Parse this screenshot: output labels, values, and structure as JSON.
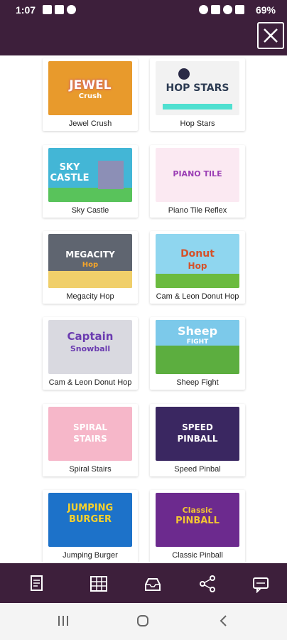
{
  "status_bar": {
    "time": "1:07",
    "battery": "69%",
    "left_icons": [
      "image-icon",
      "calendar-icon",
      "lock-icon"
    ],
    "right_icons": [
      "alarm-icon",
      "mute-icon",
      "wifi-icon",
      "signal-icon",
      "battery-icon"
    ]
  },
  "header": {
    "close_icon": "close-icon"
  },
  "games": [
    {
      "label": "Jewel Crush",
      "thumb_text": "JEWEL",
      "thumb_sub": "Crush",
      "bg": "#e89a2c",
      "fg": "#ffffff"
    },
    {
      "label": "Hop Stars",
      "thumb_text": "HOP STARS",
      "thumb_sub": "",
      "bg": "#f2f2f2",
      "fg": "#2c3b52"
    },
    {
      "label": "Sky Castle",
      "thumb_text": "SKY CASTLE",
      "thumb_sub": "",
      "bg": "#43b6d6",
      "fg": "#ffffff"
    },
    {
      "label": "Piano Tile Reflex",
      "thumb_text": "PIANO TILE",
      "thumb_sub": "",
      "bg": "#fbe9f2",
      "fg": "#9b3fb5"
    },
    {
      "label": "Megacity Hop",
      "thumb_text": "MEGACITY",
      "thumb_sub": "Hop",
      "bg": "#5f6570",
      "fg": "#ffffff"
    },
    {
      "label": "Cam & Leon Donut Hop",
      "thumb_text": "Donut",
      "thumb_sub": "Hop",
      "bg": "#8fd6ef",
      "fg": "#d5522a"
    },
    {
      "label": "Cam & Leon Donut Hop",
      "thumb_text": "Captain",
      "thumb_sub": "Snowball",
      "bg": "#d9d9e0",
      "fg": "#6b3cb0"
    },
    {
      "label": "Sheep Fight",
      "thumb_text": "Sheep",
      "thumb_sub": "FIGHT",
      "bg": "#5cae3f",
      "fg": "#ffffff"
    },
    {
      "label": "Spiral Stairs",
      "thumb_text": "SPIRAL",
      "thumb_sub": "STAIRS",
      "bg": "#f6b7c9",
      "fg": "#ffffff"
    },
    {
      "label": "Speed Pinbal",
      "thumb_text": "SPEED",
      "thumb_sub": "PINBALL",
      "bg": "#3a2761",
      "fg": "#ffffff"
    },
    {
      "label": "Jumping Burger",
      "thumb_text": "JUMPING",
      "thumb_sub": "BURGER",
      "bg": "#1d72c9",
      "fg": "#f7d12c"
    },
    {
      "label": "Classic Pinball",
      "thumb_text": "Classic",
      "thumb_sub": "PINBALL",
      "bg": "#6c2a8e",
      "fg": "#f3c532"
    }
  ],
  "bottom_bar": {
    "icons": [
      "document-icon",
      "grid-icon",
      "inbox-icon",
      "share-icon",
      "chat-icon"
    ]
  },
  "nav_bar": {
    "icons": [
      "recents-icon",
      "home-icon",
      "back-icon"
    ]
  }
}
